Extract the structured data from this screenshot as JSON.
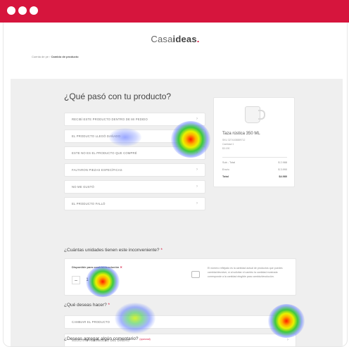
{
  "colors": {
    "brand": "#d6153d",
    "background": "#efefef",
    "card": "#ffffff"
  },
  "browser": {
    "dots": [
      "dot-1",
      "dot-2",
      "dot-3"
    ]
  },
  "header": {
    "logo_light": "Casa",
    "logo_bold": "ideas",
    "logo_dot": "."
  },
  "breadcrumb": {
    "parent": "Cuenta de pe",
    "separator": "›",
    "current": "Cambio de producto"
  },
  "page_title": "¿Qué pasó con tu producto?",
  "reasons": [
    "RECIBÍ ESTE PRODUCTO DENTRO DE MI PEDIDO",
    "EL PRODUCTO LLEGÓ DAÑADO",
    "ESTE NO ES EL PRODUCTO QUE COMPRÉ",
    "FALTARON PIEZAS ESPECÍFICAS",
    "NO ME GUSTÓ",
    "EL PRODUCTO FALLÓ"
  ],
  "reason_arrow": "›",
  "product": {
    "name": "Taza rústica 350 ML",
    "sku": "SKU 3274108889712",
    "qty_label": "Cantidad 1",
    "price": "$3.190",
    "summary": [
      {
        "label": "Sub - Total",
        "value": "$ 2.988"
      },
      {
        "label": "Envío",
        "value": "$ 3.990"
      },
      {
        "label": "Total",
        "value": "$4.980"
      }
    ]
  },
  "quantity_question": {
    "text": "¿Cuántas unidades tienen este inconveniente?",
    "required": "*"
  },
  "quantity_box": {
    "label": "Disponible para cambio/devolución",
    "label_mark": "✕",
    "minus": "−",
    "value": "1",
    "note": "El número reflejado es la cantidad actual de productos que puedes cambiar/devolver, si al solicitar el cambio la cantidad mostrada corresponde a la cantidad elegible para cambio/devolución."
  },
  "action_question": {
    "text": "¿Qué deseas hacer?",
    "required": "*"
  },
  "actions": [
    "CAMBIAR EL PRODUCTO",
    "SOLICITAR REEMBOLSO DEL DINERO"
  ],
  "action_arrow": "›",
  "comment_question": {
    "text": "¿Deseas agregar algún comentario?",
    "optional": "(opcional)"
  },
  "heatmap_level": [
    "high",
    "low",
    "high",
    "low",
    "high"
  ]
}
